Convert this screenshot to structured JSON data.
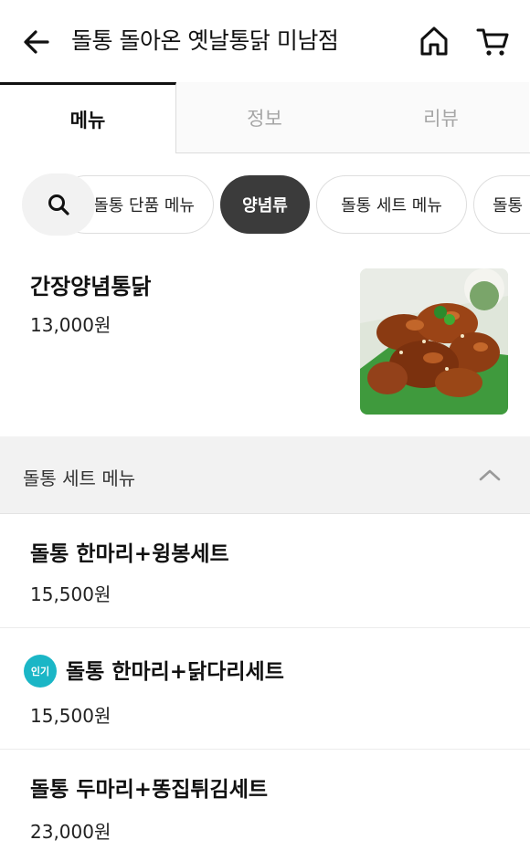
{
  "header": {
    "title": "돌통 돌아온 옛날통닭 미남점",
    "back_icon": "back-arrow-icon",
    "home_icon": "home-icon",
    "cart_icon": "cart-icon"
  },
  "tabs": [
    {
      "label": "메뉴",
      "active": true
    },
    {
      "label": "정보",
      "active": false
    },
    {
      "label": "리뷰",
      "active": false
    }
  ],
  "categories": {
    "search_icon": "search-icon",
    "chips": [
      {
        "label": "돌통 단품 메뉴",
        "selected": false
      },
      {
        "label": "양념류",
        "selected": true
      },
      {
        "label": "돌통 세트 메뉴",
        "selected": false
      },
      {
        "label": "돌통",
        "selected": false
      }
    ]
  },
  "featured": {
    "name": "간장양념통닭",
    "price": "13,000원"
  },
  "section": {
    "title": "돌통 세트 메뉴",
    "collapse_icon": "chevron-up-icon"
  },
  "items": [
    {
      "name": "돌통 한마리+윙봉세트",
      "price": "15,500원"
    },
    {
      "name": "돌통 한마리+닭다리세트",
      "price": "15,500원",
      "badge": "인기"
    },
    {
      "name": "돌통 두마리+똥집튀김세트",
      "price": "23,000원"
    }
  ],
  "colors": {
    "selected_chip": "#3b3b3b",
    "badge": "#1bb6c6",
    "section_bg": "#f2f2f2"
  }
}
